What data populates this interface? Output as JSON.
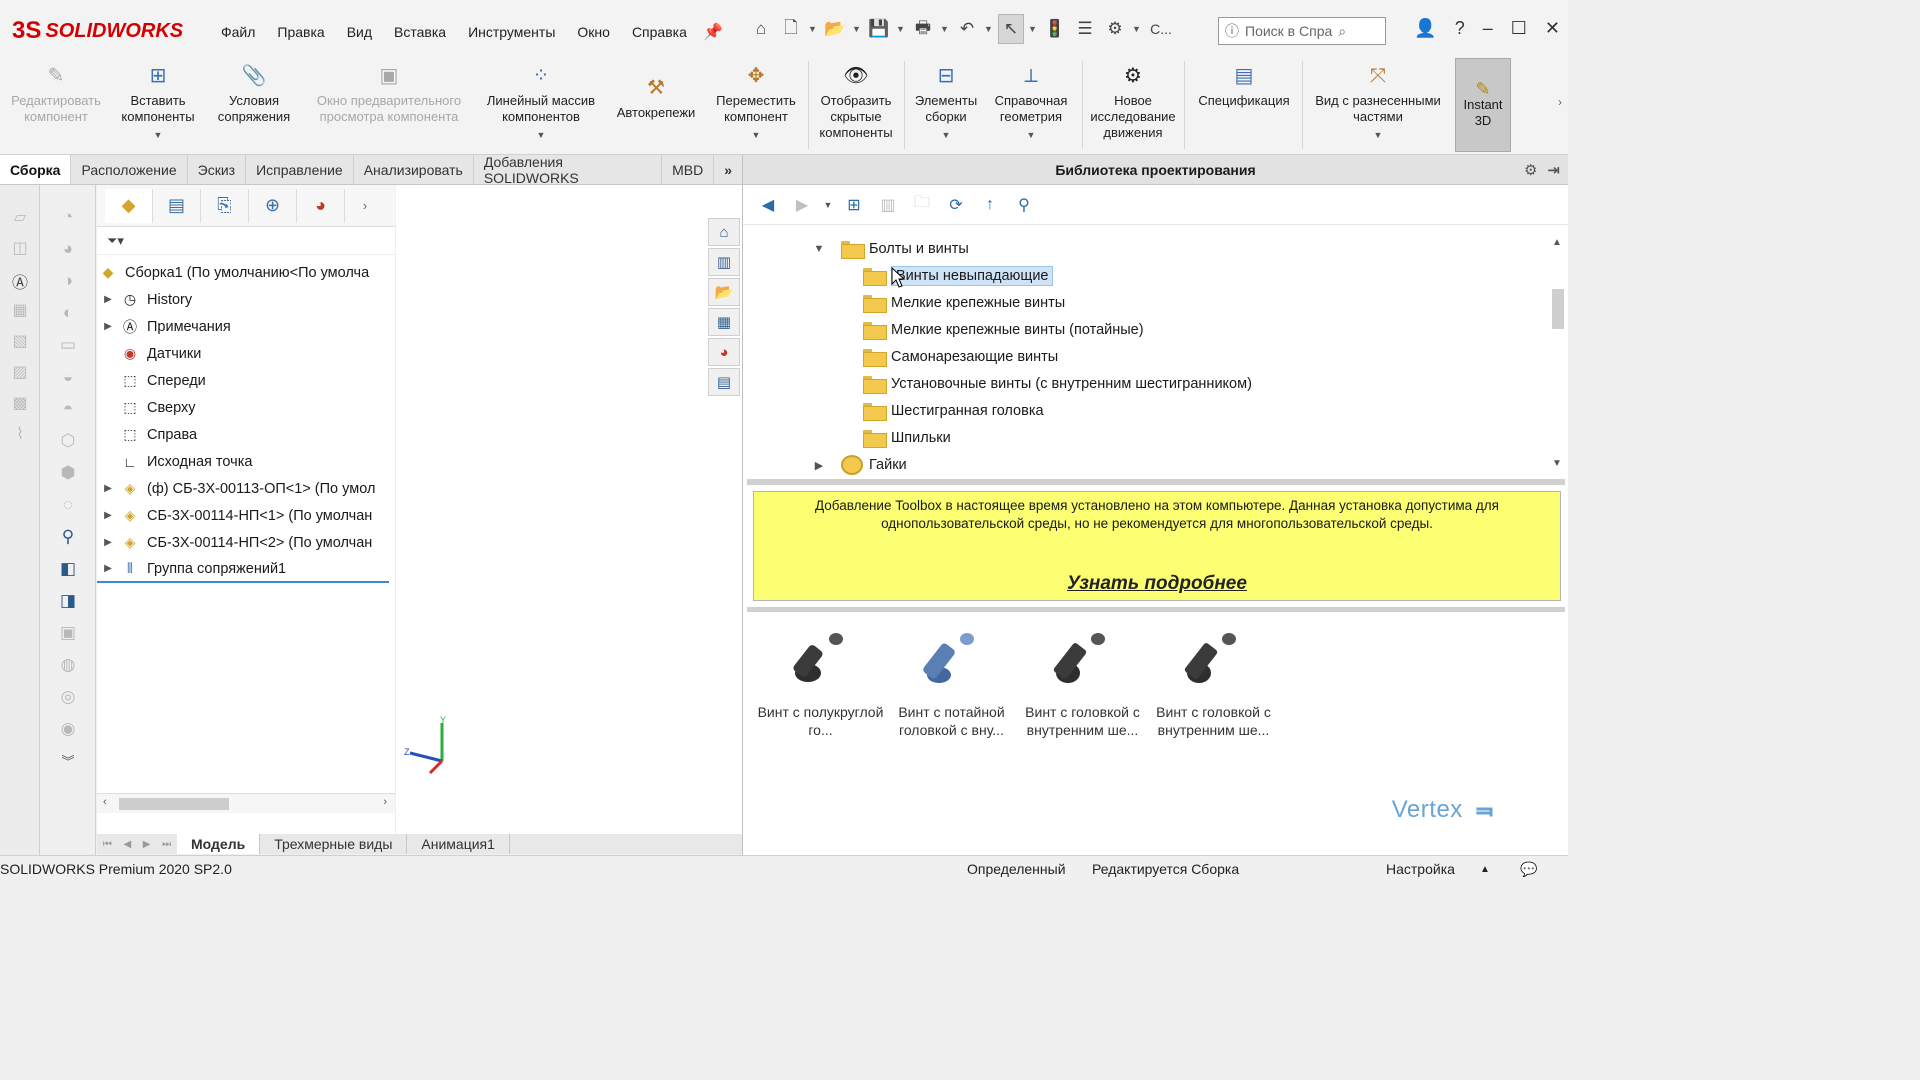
{
  "app": {
    "logo_text": "SOLIDWORKS",
    "logo_mark": "3S"
  },
  "menu": [
    "Файл",
    "Правка",
    "Вид",
    "Вставка",
    "Инструменты",
    "Окно",
    "Справка"
  ],
  "search": {
    "placeholder": "Поиск в Спра",
    "short_label": "C..."
  },
  "ribbon": {
    "buttons": [
      {
        "label": "Редактировать компонент",
        "disabled": true,
        "icon": "edit-component-icon"
      },
      {
        "label": "Вставить компоненты",
        "disabled": false,
        "icon": "insert-components-icon"
      },
      {
        "label": "Условия сопряжения",
        "disabled": false,
        "icon": "mate-icon"
      },
      {
        "label": "Окно предварительного просмотра компонента",
        "disabled": true,
        "icon": "preview-window-icon"
      },
      {
        "label": "Линейный массив компонентов",
        "disabled": false,
        "icon": "linear-pattern-icon"
      },
      {
        "label": "Автокрепежи",
        "disabled": false,
        "icon": "smart-fasteners-icon"
      },
      {
        "label": "Переместить компонент",
        "disabled": false,
        "icon": "move-component-icon"
      },
      {
        "label": "Отобразить скрытые компоненты",
        "disabled": false,
        "icon": "show-hidden-icon"
      },
      {
        "label": "Элементы сборки",
        "disabled": false,
        "icon": "assembly-features-icon"
      },
      {
        "label": "Справочная геометрия",
        "disabled": false,
        "icon": "reference-geometry-icon"
      },
      {
        "label": "Новое исследование движения",
        "disabled": false,
        "icon": "motion-study-icon"
      },
      {
        "label": "Спецификация",
        "disabled": false,
        "icon": "bom-icon"
      },
      {
        "label": "Вид с разнесенными частями",
        "disabled": false,
        "icon": "exploded-view-icon"
      }
    ],
    "instant3d": "Instant 3D"
  },
  "tabs": [
    "Сборка",
    "Расположение",
    "Эскиз",
    "Исправление",
    "Анализировать",
    "Добавления SOLIDWORKS",
    "MBD"
  ],
  "tabs_more": "»",
  "tree": {
    "root": "Сборка1  (По умолчанию<По умолча",
    "items": [
      {
        "label": "History",
        "expander": true,
        "icon": "history-icon"
      },
      {
        "label": "Примечания",
        "expander": true,
        "icon": "annotations-icon"
      },
      {
        "label": "Датчики",
        "expander": false,
        "icon": "sensors-icon"
      },
      {
        "label": "Спереди",
        "expander": false,
        "icon": "plane-icon"
      },
      {
        "label": "Сверху",
        "expander": false,
        "icon": "plane-icon"
      },
      {
        "label": "Справа",
        "expander": false,
        "icon": "plane-icon"
      },
      {
        "label": "Исходная точка",
        "expander": false,
        "icon": "origin-icon"
      },
      {
        "label": "(ф) СБ-3Х-00113-ОП<1> (По умол",
        "expander": true,
        "icon": "subassembly-icon"
      },
      {
        "label": "СБ-3Х-00114-НП<1> (По умолчан",
        "expander": true,
        "icon": "subassembly-icon"
      },
      {
        "label": "СБ-3Х-00114-НП<2> (По умолчан",
        "expander": true,
        "icon": "subassembly-icon"
      },
      {
        "label": "Группа сопряжений1",
        "expander": true,
        "icon": "mates-icon"
      }
    ]
  },
  "bottom_tabs": [
    "Модель",
    "Трехмерные виды",
    "Анимация1"
  ],
  "design_library": {
    "title": "Библиотека проектирования",
    "folder_parent": "Болты и винты",
    "folders": [
      "Винты невыпадающие",
      "Мелкие крепежные винты",
      "Мелкие крепежные винты (потайные)",
      "Самонарезающие винты",
      "Установочные винты (с внутренним шестигранником)",
      "Шестигранная головка",
      "Шпильки"
    ],
    "next_group": "Гайки",
    "notice_text": "Добавление Toolbox в настоящее время установлено на этом компьютере. Данная установка допустима для однопользовательской среды, но не рекомендуется для многопользовательской среды.",
    "notice_link": "Узнать подробнее",
    "parts": [
      {
        "label": "Винт с полукруглой го...",
        "color": "#3b3b3b"
      },
      {
        "label": "Винт с потайной головкой с вну...",
        "color": "#5a7fb5"
      },
      {
        "label": "Винт с головкой с внутренним ше...",
        "color": "#3b3b3b"
      },
      {
        "label": "Винт с головкой с внутренним ше...",
        "color": "#3b3b3b"
      }
    ],
    "watermark": "Vertex"
  },
  "status": {
    "version": "SOLIDWORKS Premium 2020 SP2.0",
    "state": "Определенный",
    "editing": "Редактируется Сборка",
    "settings": "Настройка"
  },
  "colors": {
    "accent": "#d40000",
    "notice_bg": "#fcff72",
    "folder": "#f2c94c"
  }
}
